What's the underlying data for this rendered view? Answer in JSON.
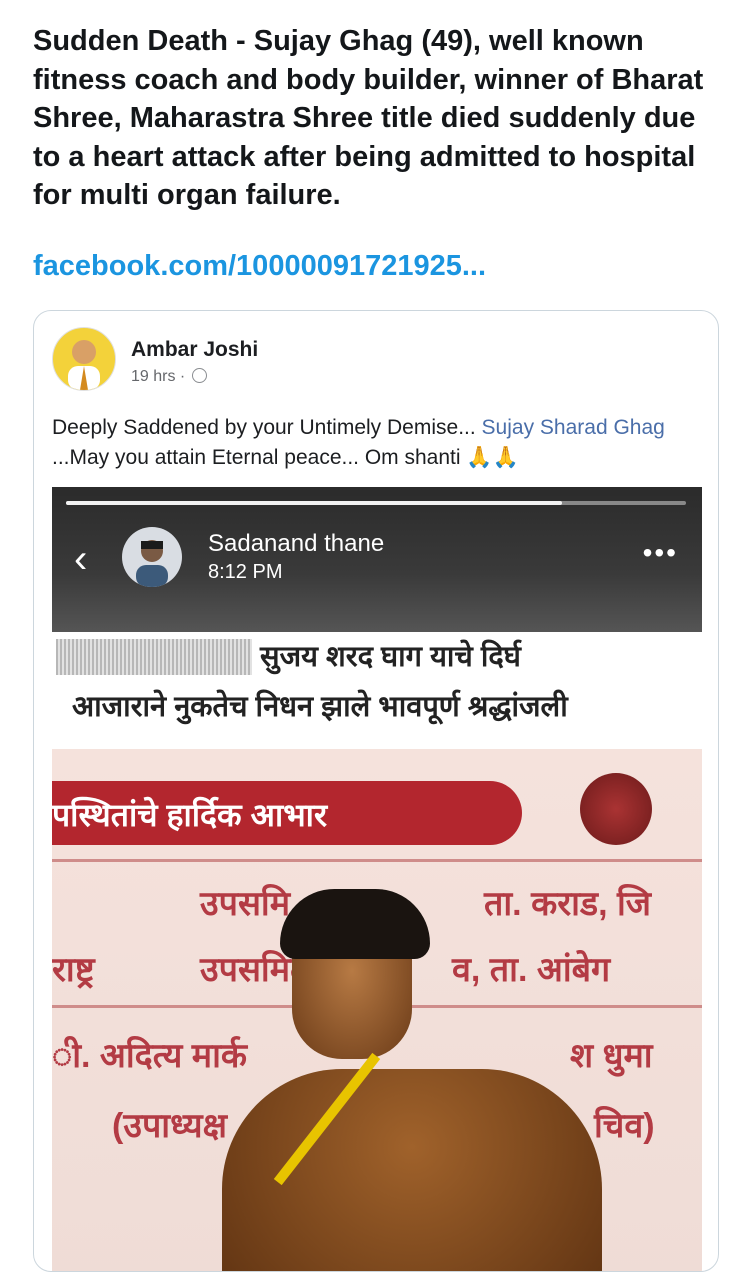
{
  "tweet": {
    "text": "Sudden Death - Sujay Ghag (49), well known fitness coach and body builder, winner of Bharat Shree, Maharastra Shree title died suddenly due to a heart attack after being admitted to hospital for multi organ failure.",
    "link": "facebook.com/10000091721925..."
  },
  "facebook_post": {
    "author": "Ambar Joshi",
    "time": "19 hrs · ",
    "text_before": "Deeply Saddened by your Untimely Demise... ",
    "tagged_name": "Sujay Sharad Ghag",
    "text_after": " ...May you attain Eternal peace... Om shanti 🙏🙏",
    "avatar_icon": "person-avatar-icon",
    "privacy_icon": "globe-icon"
  },
  "story": {
    "name": "Sadanand thane",
    "time": "8:12 PM",
    "back_icon": "chevron-left-icon",
    "more_icon": "more-dots-icon",
    "progress_fraction": 0.8,
    "caption_line1": "सुजय शरद घाग याचे दिर्घ",
    "caption_line2": "आजाराने नुकतेच निधन झाले भावपूर्ण श्रद्धांजली"
  },
  "photo_signage": {
    "banner": "पस्थितांचे हार्दिक आभार",
    "line1_left": "उपसमि",
    "line1_right": "ता. कराड, जि",
    "line2_left": "राष्ट्र",
    "line2_mid": "उपसमित",
    "line2_right": "व, ता. आंबेग",
    "line3_left": "ी. अदित्य मार्क",
    "line3_right": "श धुमा",
    "line4_left": "(उपाध्यक्ष",
    "line4_right": "चिव)"
  }
}
